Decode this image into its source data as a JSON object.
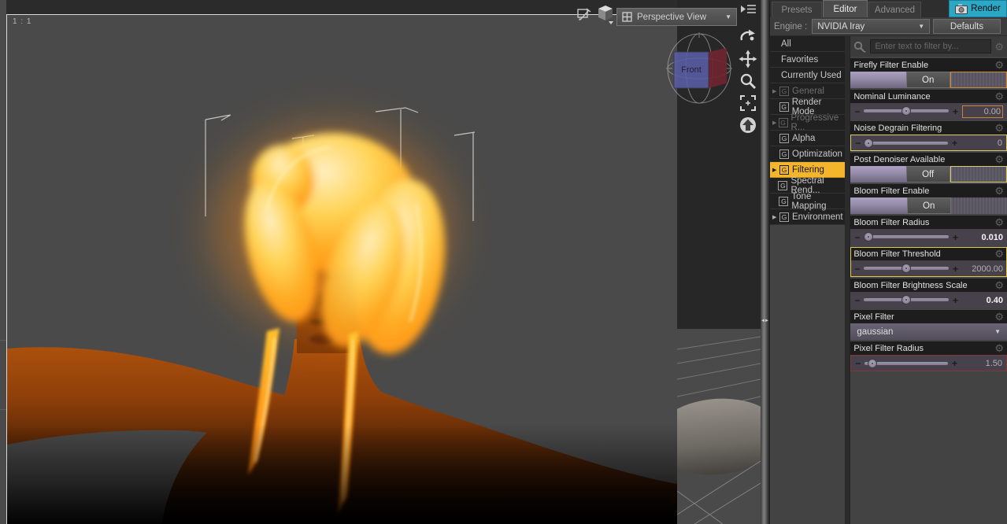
{
  "viewport": {
    "ratio_label": "1 : 1",
    "view_selector": {
      "label": "Perspective View"
    },
    "nav_cube": {
      "front_label": "Front"
    }
  },
  "panel": {
    "tabs": [
      {
        "label": "Presets",
        "active": false
      },
      {
        "label": "Editor",
        "active": true
      },
      {
        "label": "Advanced",
        "active": false
      }
    ],
    "render_button": {
      "label": "Render"
    },
    "engine": {
      "label": "Engine :",
      "value": "NVIDIA Iray"
    },
    "defaults_button": {
      "label": "Defaults"
    },
    "search": {
      "placeholder": "Enter text to filter by..."
    },
    "categories": [
      {
        "label": "All",
        "style": "plain"
      },
      {
        "label": "Favorites",
        "style": "plain"
      },
      {
        "label": "Currently Used",
        "style": "plain"
      },
      {
        "label": "General",
        "icon": "G",
        "arrow": true,
        "dim": true
      },
      {
        "label": "Render Mode",
        "icon": "G"
      },
      {
        "label": "Progressive R...",
        "icon": "G",
        "arrow": true,
        "dim": true
      },
      {
        "label": "Alpha",
        "icon": "G"
      },
      {
        "label": "Optimization",
        "icon": "G"
      },
      {
        "label": "Filtering",
        "icon": "G",
        "arrow": true,
        "selected": true
      },
      {
        "label": "Spectral Rend...",
        "icon": "G"
      },
      {
        "label": "Tone Mapping",
        "icon": "G"
      },
      {
        "label": "Environment",
        "icon": "G",
        "arrow": true
      }
    ],
    "parameters": [
      {
        "name": "Firefly Filter Enable",
        "type": "toggle",
        "value": "On",
        "accent": "orange"
      },
      {
        "name": "Nominal Luminance",
        "type": "slider",
        "value": "0.00",
        "pos": 0.5,
        "value_accent": true
      },
      {
        "name": "Noise Degrain Filtering",
        "type": "slider",
        "value": "0",
        "pos": 0.04,
        "accent": "yellow"
      },
      {
        "name": "Post Denoiser Available",
        "type": "toggle",
        "value": "Off",
        "accent": "yellow"
      },
      {
        "name": "Bloom Filter Enable",
        "type": "toggle",
        "value": "On"
      },
      {
        "name": "Bloom Filter Radius",
        "type": "slider",
        "value": "0.010",
        "pos": 0.05,
        "bright": true
      },
      {
        "name": "Bloom Filter Threshold",
        "type": "slider",
        "value": "2000.00",
        "pos": 0.5,
        "selected": true
      },
      {
        "name": "Bloom Filter Brightness Scale",
        "type": "slider",
        "value": "0.40",
        "pos": 0.5,
        "bright": true
      },
      {
        "name": "Pixel Filter",
        "type": "dropdown",
        "value": "gaussian"
      },
      {
        "name": "Pixel Filter Radius",
        "type": "slider",
        "value": "1.50",
        "pos": 0.09,
        "accent": "maroon"
      }
    ]
  },
  "colors": {
    "selection_gold": "#f2b52c",
    "render_button_teal": "#2ba8c6",
    "highlight_yellow": "#dfc945",
    "highlight_orange": "#cf8a3a",
    "hair_glow": "#ffb020",
    "skin": "#9a4410"
  }
}
